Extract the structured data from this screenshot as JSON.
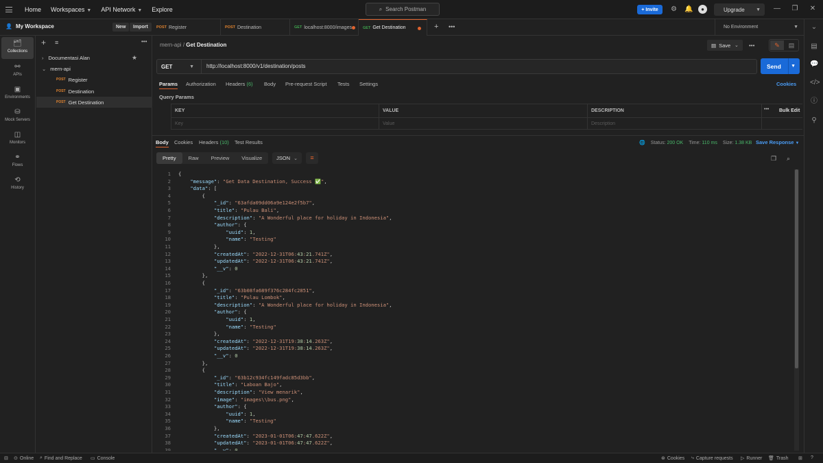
{
  "topbar": {
    "nav": [
      "Home",
      "Workspaces",
      "API Network",
      "Explore"
    ],
    "search_placeholder": "Search Postman",
    "invite": "Invite",
    "upgrade": "Upgrade"
  },
  "workspace": {
    "title": "My Workspace",
    "new": "New",
    "import": "Import"
  },
  "tabs": [
    {
      "method": "POST",
      "label": "Register"
    },
    {
      "method": "POST",
      "label": "Destination"
    },
    {
      "method": "GET",
      "label": "localhost:8000/images"
    },
    {
      "method": "GET",
      "label": "Get Destination"
    }
  ],
  "environment": "No Environment",
  "iconbar": [
    "Collections",
    "APIs",
    "Environments",
    "Mock Servers",
    "Monitors",
    "Flows",
    "History"
  ],
  "tree": {
    "collections": [
      "Documentasi Alan",
      "mern-api"
    ],
    "requests": [
      {
        "method": "POST",
        "label": "Register"
      },
      {
        "method": "POST",
        "label": "Destination"
      },
      {
        "method": "POST",
        "label": "Get Destination"
      }
    ]
  },
  "request": {
    "breadcrumb_parent": "mern-api",
    "breadcrumb_sep": "/",
    "name": "Get Destination",
    "save": "Save",
    "method": "GET",
    "url": "http://localhost:8000/v1/destination/posts",
    "send": "Send",
    "tabs": [
      "Params",
      "Authorization",
      "Headers",
      "(6)",
      "Body",
      "Pre-request Script",
      "Tests",
      "Settings"
    ],
    "cookies": "Cookies",
    "query_params": "Query Params",
    "table_headers": [
      "KEY",
      "VALUE",
      "DESCRIPTION"
    ],
    "bulk_edit": "Bulk Edit",
    "placeholders": [
      "Key",
      "Value",
      "Description"
    ]
  },
  "response": {
    "tabs": [
      "Body",
      "Cookies",
      "Headers",
      "(10)",
      "Test Results"
    ],
    "status_label": "Status:",
    "status": "200 OK",
    "time_label": "Time:",
    "time": "110 ms",
    "size_label": "Size:",
    "size": "1.38 KB",
    "save_response": "Save Response",
    "views": [
      "Pretty",
      "Raw",
      "Preview",
      "Visualize"
    ],
    "format": "JSON"
  },
  "code_lines": [
    "{",
    "    \"message\": \"Get Data Destination, Success ✅\",",
    "    \"data\": [",
    "        {",
    "            \"_id\": \"63afda09dd06a9e124e2f5b7\",",
    "            \"title\": \"Pulau Bali\",",
    "            \"description\": \"A Wonderful place for holiday in Indonesia\",",
    "            \"author\": {",
    "                \"uuid\": 1,",
    "                \"name\": \"Testing\"",
    "            },",
    "            \"createdAt\": \"2022-12-31T06:43:21.741Z\",",
    "            \"updatedAt\": \"2022-12-31T06:43:21.741Z\",",
    "            \"__v\": 0",
    "        },",
    "        {",
    "            \"_id\": \"63b08fa689f376c284fc2851\",",
    "            \"title\": \"Pulau Lombok\",",
    "            \"description\": \"A Wonderful place for holiday in Indonesia\",",
    "            \"author\": {",
    "                \"uuid\": 1,",
    "                \"name\": \"Testing\"",
    "            },",
    "            \"createdAt\": \"2022-12-31T19:38:14.263Z\",",
    "            \"updatedAt\": \"2022-12-31T19:38:14.263Z\",",
    "            \"__v\": 0",
    "        },",
    "        {",
    "            \"_id\": \"63b12c934fc149fadc85d3bb\",",
    "            \"title\": \"Laboan Bajo\",",
    "            \"description\": \"View menarik\",",
    "            \"image\": \"images\\\\bus.png\",",
    "            \"author\": {",
    "                \"uuid\": 1,",
    "                \"name\": \"Testing\"",
    "            },",
    "            \"createdAt\": \"2023-01-01T06:47:47.622Z\",",
    "            \"updatedAt\": \"2023-01-01T06:47:47.622Z\",",
    "            \"__v\": 0"
  ],
  "statusbar": {
    "left": [
      "Online",
      "Find and Replace",
      "Console"
    ],
    "right": [
      "Cookies",
      "Capture requests",
      "Runner",
      "Trash"
    ]
  },
  "colors": {
    "accent": "#e0632f",
    "primary": "#1a6ad8",
    "get": "#3fa34d",
    "post": "#e0832f",
    "status_ok": "#49b86a"
  }
}
